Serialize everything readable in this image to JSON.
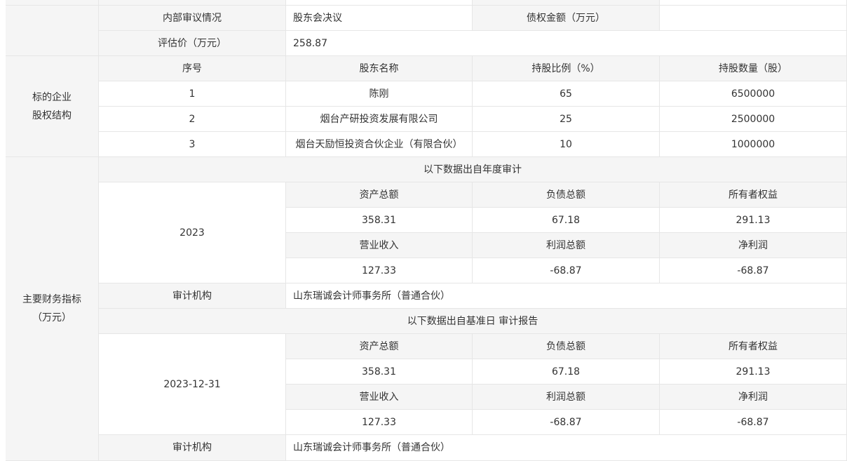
{
  "review_row": {
    "internal_review_label": "内部审议情况",
    "internal_review_value": "股东会决议",
    "debt_amount_label": "债权金额（万元）",
    "debt_amount_value": ""
  },
  "valuation_row": {
    "label": "评估价（万元）",
    "value": "258.87"
  },
  "equity_structure": {
    "section_label_line1": "标的企业",
    "section_label_line2": "股权结构",
    "headers": [
      "序号",
      "股东名称",
      "持股比例（%）",
      "持股数量（股）"
    ],
    "rows": [
      {
        "no": "1",
        "name": "陈刚",
        "ratio": "65",
        "shares": "6500000"
      },
      {
        "no": "2",
        "name": "烟台产研投资发展有限公司",
        "ratio": "25",
        "shares": "2500000"
      },
      {
        "no": "3",
        "name": "烟台天励恒投资合伙企业（有限合伙）",
        "ratio": "10",
        "shares": "1000000"
      }
    ]
  },
  "financials": {
    "section_label_line1": "主要财务指标",
    "section_label_line2": "（万元）",
    "annual": {
      "banner": "以下数据出自年度审计",
      "period": "2023",
      "headers1": [
        "资产总额",
        "负债总额",
        "所有者权益"
      ],
      "values1": [
        "358.31",
        "67.18",
        "291.13"
      ],
      "headers2": [
        "营业收入",
        "利润总额",
        "净利润"
      ],
      "values2": [
        "127.33",
        "-68.87",
        "-68.87"
      ],
      "auditor_label": "审计机构",
      "auditor_value": "山东瑞诚会计师事务所（普通合伙）"
    },
    "benchmark": {
      "banner": "以下数据出自基准日 审计报告",
      "period": "2023-12-31",
      "headers1": [
        "资产总额",
        "负债总额",
        "所有者权益"
      ],
      "values1": [
        "358.31",
        "67.18",
        "291.13"
      ],
      "headers2": [
        "营业收入",
        "利润总额",
        "净利润"
      ],
      "values2": [
        "127.33",
        "-68.87",
        "-68.87"
      ],
      "auditor_label": "审计机构",
      "auditor_value": "山东瑞诚会计师事务所（普通合伙）"
    }
  }
}
